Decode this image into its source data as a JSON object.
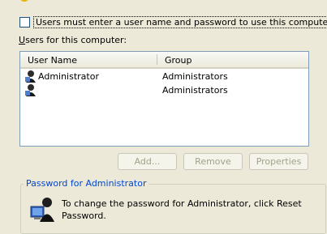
{
  "checkbox": {
    "label": "Users must enter a user name and password to use this computer.",
    "checked": false
  },
  "users_label": "Users for this computer:",
  "list": {
    "columns": [
      "User Name",
      "Group"
    ],
    "rows": [
      {
        "name": "Administrator",
        "group": "Administrators"
      },
      {
        "name": "",
        "group": "Administrators"
      }
    ]
  },
  "buttons": {
    "add": "Add...",
    "remove": "Remove",
    "properties": "Properties"
  },
  "password_group": {
    "title": "Password for Administrator",
    "text": "To change the password for Administrator, click Reset Password."
  },
  "colors": {
    "background": "#ece9d8",
    "group_title": "#0046d5",
    "disabled_text": "#a3a08b"
  }
}
